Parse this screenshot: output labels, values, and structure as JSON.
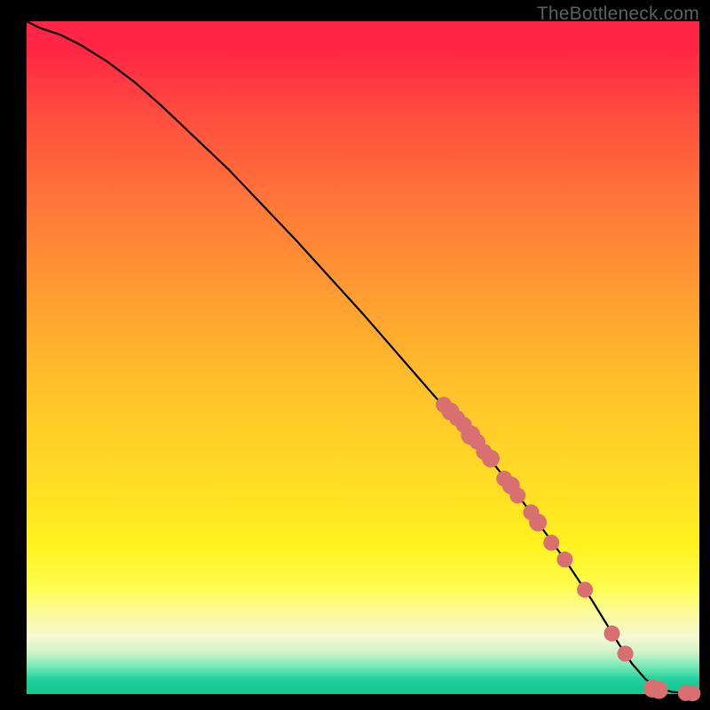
{
  "attribution": "TheBottleneck.com",
  "colors": {
    "marker": "#d87071",
    "line": "#000000"
  },
  "chart_data": {
    "type": "line",
    "title": "",
    "xlabel": "",
    "ylabel": "",
    "xlim": [
      0,
      100
    ],
    "ylim": [
      0,
      100
    ],
    "grid": false,
    "series": [
      {
        "name": "bottleneck-curve",
        "x": [
          0,
          2,
          5,
          8,
          12,
          16,
          20,
          30,
          40,
          50,
          60,
          68,
          72,
          76,
          80,
          84,
          88,
          90,
          92,
          94,
          96,
          98,
          100
        ],
        "y": [
          100,
          99,
          98,
          96.5,
          94,
          91,
          87.5,
          78,
          67.5,
          56.5,
          45,
          36,
          31,
          25.5,
          20,
          14,
          7.5,
          4.5,
          2.2,
          0.8,
          0.3,
          0.15,
          0.1
        ]
      }
    ],
    "markers": {
      "name": "highlighted-points",
      "x": [
        62,
        63,
        64,
        65,
        66,
        67,
        68,
        69,
        71,
        72,
        73,
        75,
        76,
        78,
        80,
        83,
        87,
        89,
        93,
        94,
        98,
        99
      ],
      "y": [
        43,
        42,
        41,
        40,
        38.5,
        37.5,
        36,
        35,
        32,
        31,
        29.5,
        27,
        25.5,
        22.5,
        20,
        15.5,
        9,
        6,
        0.8,
        0.6,
        0.15,
        0.1
      ],
      "r": [
        9,
        10,
        9,
        9,
        11,
        9,
        9,
        10,
        9,
        10,
        9,
        9,
        10,
        9,
        9,
        9,
        9,
        9,
        10,
        10,
        9,
        9
      ]
    }
  }
}
